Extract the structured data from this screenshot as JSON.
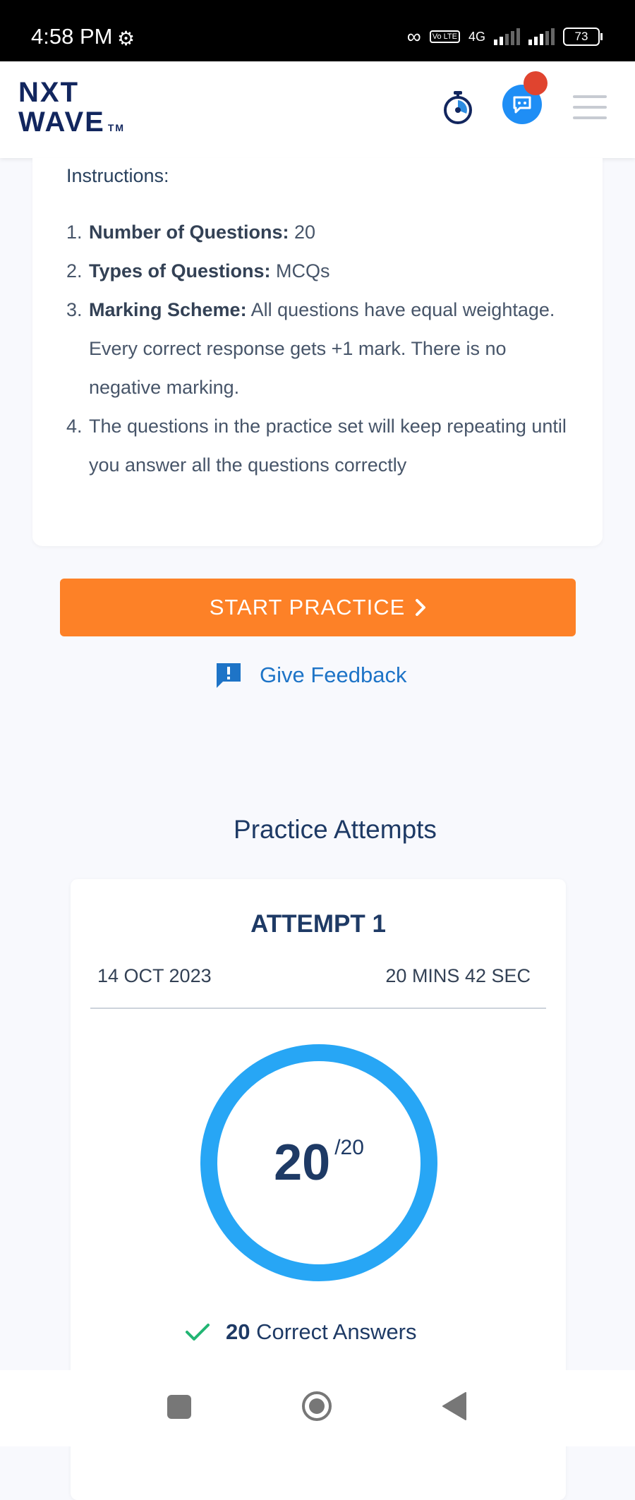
{
  "status_bar": {
    "time": "4:58 PM",
    "network_label": "4G",
    "volte_label": "Vo LTE",
    "battery": "73"
  },
  "header": {
    "logo_line1": "NXT",
    "logo_line2": "WAVE",
    "logo_tm": "TM"
  },
  "instructions": {
    "title": "Instructions:",
    "items": [
      {
        "num": "1.",
        "label": "Number of Questions:",
        "text": " 20"
      },
      {
        "num": "2.",
        "label": "Types of Questions:",
        "text": " MCQs"
      },
      {
        "num": "3.",
        "label": "Marking Scheme:",
        "text": "  All questions have equal weightage. Every correct response gets +1 mark. There is no negative marking."
      },
      {
        "num": "4.",
        "label": "",
        "text": "The questions in the practice set will keep repeating until you answer all the questions correctly"
      }
    ]
  },
  "actions": {
    "start_label": "START PRACTICE",
    "feedback_label": "Give Feedback"
  },
  "attempts": {
    "section_title": "Practice Attempts",
    "items": [
      {
        "title": "ATTEMPT 1",
        "date": "14 OCT 2023",
        "duration": "20 MINS 42 SEC",
        "score": "20",
        "total": "/20",
        "correct_count": "20",
        "correct_label": "Correct Answers"
      }
    ]
  },
  "colors": {
    "accent_orange": "#fd8127",
    "ring_blue": "#27a6f5",
    "check_green": "#22b573",
    "navy": "#1e3a65",
    "link_blue": "#1e74c7"
  }
}
